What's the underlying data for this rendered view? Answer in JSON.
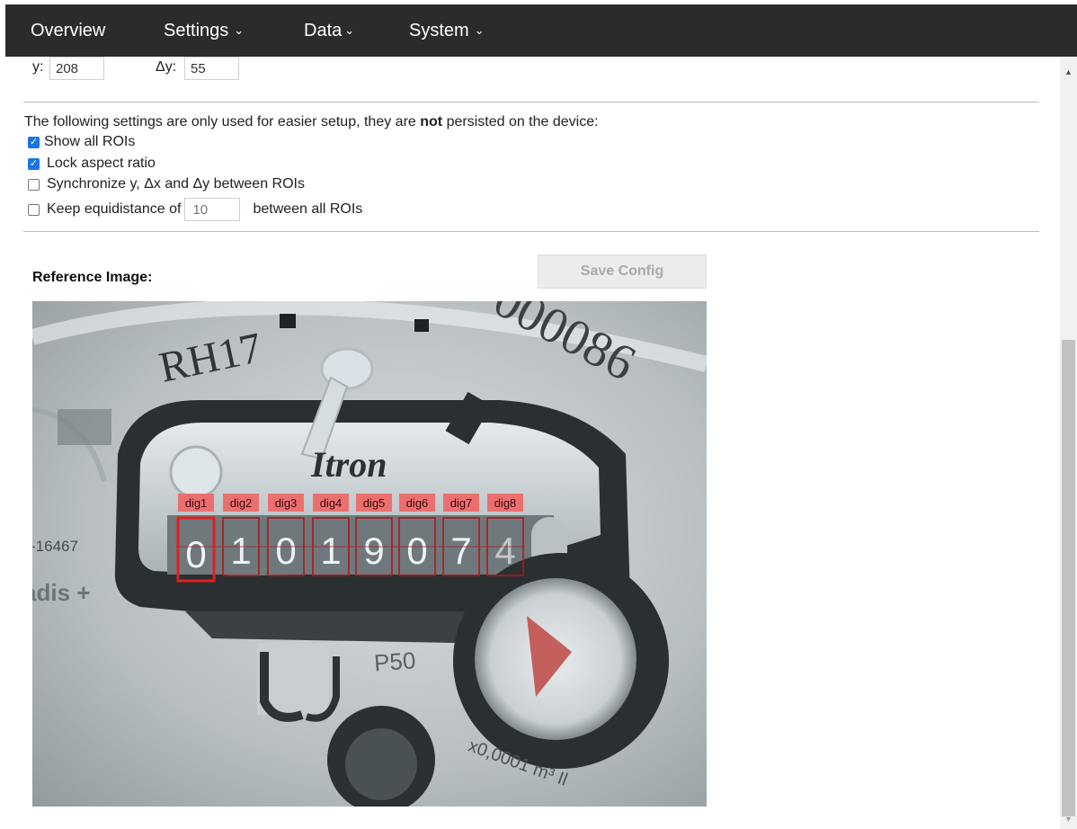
{
  "nav": {
    "overview": "Overview",
    "settings": "Settings",
    "data": "Data",
    "system": "System"
  },
  "coords": {
    "y_label": "y:",
    "y_value": "208",
    "dy_label": "Δy:",
    "dy_value": "55"
  },
  "setup": {
    "notice_pre": "The following settings are only used for easier setup, they are ",
    "notice_bold": "not",
    "notice_post": " persisted on the device:",
    "show_all_rois": {
      "label": "Show all ROIs",
      "checked": true
    },
    "lock_aspect": {
      "label": "Lock aspect ratio",
      "checked": true
    },
    "sync": {
      "label": "Synchronize y, Δx and Δy between ROIs",
      "checked": false
    },
    "equidistance": {
      "label_pre": "Keep equidistance of",
      "value": "10",
      "label_post": "between all ROIs",
      "checked": false
    }
  },
  "reference": {
    "heading": "Reference Image:",
    "save_button": "Save Config",
    "meter_texts": [
      "RH17",
      "000086",
      "Itron",
      "-16467",
      "adis +",
      "P50",
      "x0,0001 m³ Il"
    ],
    "rois": [
      "dig1",
      "dig2",
      "dig3",
      "dig4",
      "dig5",
      "dig6",
      "dig7",
      "dig8"
    ],
    "digits": [
      "0",
      "1",
      "0",
      "1",
      "9",
      "0",
      "7",
      "4"
    ],
    "selected_roi": "dig1"
  },
  "colors": {
    "nav_bg": "#2b2b2b",
    "roi_red": "#e02020",
    "checkbox_blue": "#1a73e8"
  }
}
